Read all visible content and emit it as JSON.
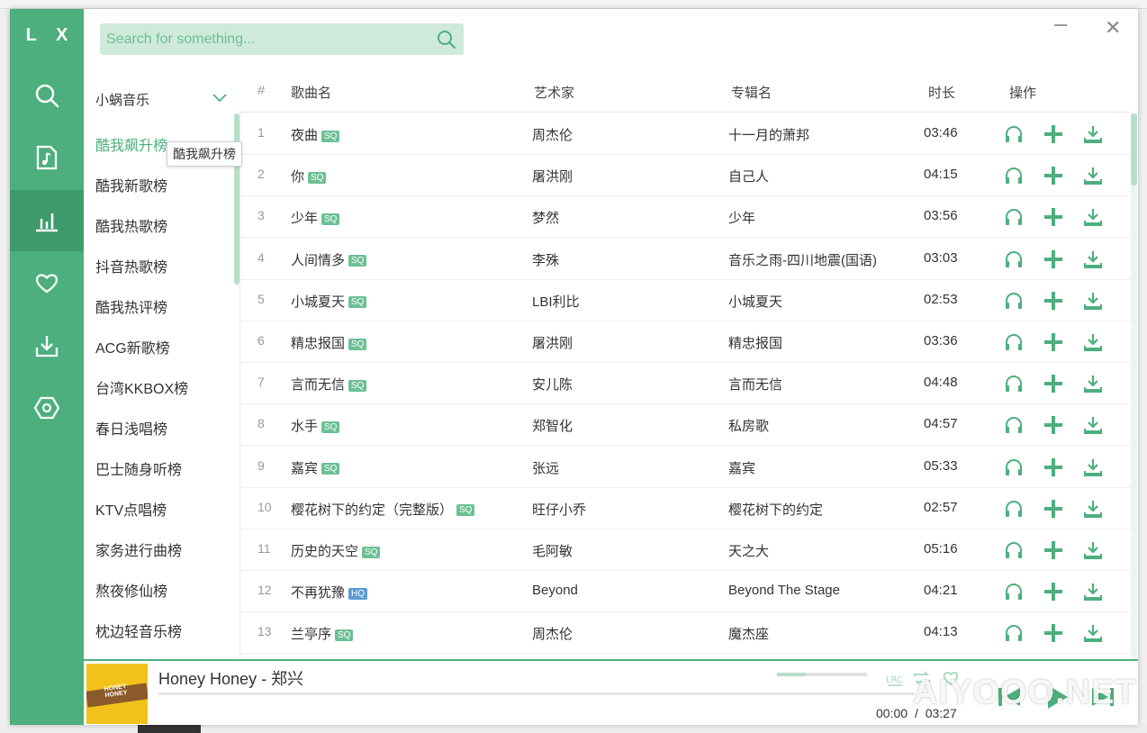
{
  "app": {
    "logo": "L X"
  },
  "search": {
    "placeholder": "Search for something..."
  },
  "source": {
    "label": "小蜗音乐"
  },
  "boards": [
    "酷我飙升榜",
    "酷我新歌榜",
    "酷我热歌榜",
    "抖音热歌榜",
    "酷我热评榜",
    "ACG新歌榜",
    "台湾KKBOX榜",
    "春日浅唱榜",
    "巴士随身听榜",
    "KTV点唱榜",
    "家务进行曲榜",
    "熬夜修仙榜",
    "枕边轻音乐榜"
  ],
  "tooltip": "酷我飙升榜",
  "table": {
    "headers": {
      "num": "#",
      "name": "歌曲名",
      "artist": "艺术家",
      "album": "专辑名",
      "duration": "时长",
      "action": "操作"
    },
    "rows": [
      {
        "num": "1",
        "name": "夜曲",
        "quality": "SQ",
        "artist": "周杰伦",
        "album": "十一月的萧邦",
        "duration": "03:46"
      },
      {
        "num": "2",
        "name": "你",
        "quality": "SQ",
        "artist": "屠洪刚",
        "album": "自己人",
        "duration": "04:15"
      },
      {
        "num": "3",
        "name": "少年",
        "quality": "SQ",
        "artist": "梦然",
        "album": "少年",
        "duration": "03:56"
      },
      {
        "num": "4",
        "name": "人间情多",
        "quality": "SQ",
        "artist": "李殊",
        "album": "音乐之雨-四川地震(国语)",
        "duration": "03:03"
      },
      {
        "num": "5",
        "name": "小城夏天",
        "quality": "SQ",
        "artist": "LBI利比",
        "album": "小城夏天",
        "duration": "02:53"
      },
      {
        "num": "6",
        "name": "精忠报国",
        "quality": "SQ",
        "artist": "屠洪刚",
        "album": "精忠报国",
        "duration": "03:36"
      },
      {
        "num": "7",
        "name": "言而无信",
        "quality": "SQ",
        "artist": "安儿陈",
        "album": "言而无信",
        "duration": "04:48"
      },
      {
        "num": "8",
        "name": "水手",
        "quality": "SQ",
        "artist": "郑智化",
        "album": "私房歌",
        "duration": "04:57"
      },
      {
        "num": "9",
        "name": "嘉宾",
        "quality": "SQ",
        "artist": "张远",
        "album": "嘉宾",
        "duration": "05:33"
      },
      {
        "num": "10",
        "name": "樱花树下的约定（完整版）",
        "quality": "SQ",
        "artist": "旺仔小乔",
        "album": "樱花树下的约定",
        "duration": "02:57"
      },
      {
        "num": "11",
        "name": "历史的天空",
        "quality": "SQ",
        "artist": "毛阿敏",
        "album": "天之大",
        "duration": "05:16"
      },
      {
        "num": "12",
        "name": "不再犹豫",
        "quality": "HQ",
        "artist": "Beyond",
        "album": "Beyond The Stage",
        "duration": "04:21"
      },
      {
        "num": "13",
        "name": "兰亭序",
        "quality": "SQ",
        "artist": "周杰伦",
        "album": "魔杰座",
        "duration": "04:13"
      }
    ]
  },
  "player": {
    "title": "Honey Honey - 郑兴",
    "current_time": "00:00",
    "separator": "/",
    "total_time": "03:27",
    "lrc_label": "LRC",
    "volume": 0.32,
    "progress": 0.0,
    "cover_text": "HONEY HONEY"
  },
  "watermark": "AIYOOO.NET",
  "colors": {
    "accent": "#4caf7d",
    "sidebar": "#4caf7d",
    "sidebar_active": "#3f9a6b",
    "tag_sq": "#6cc094",
    "tag_hq": "#5b9bd5"
  }
}
